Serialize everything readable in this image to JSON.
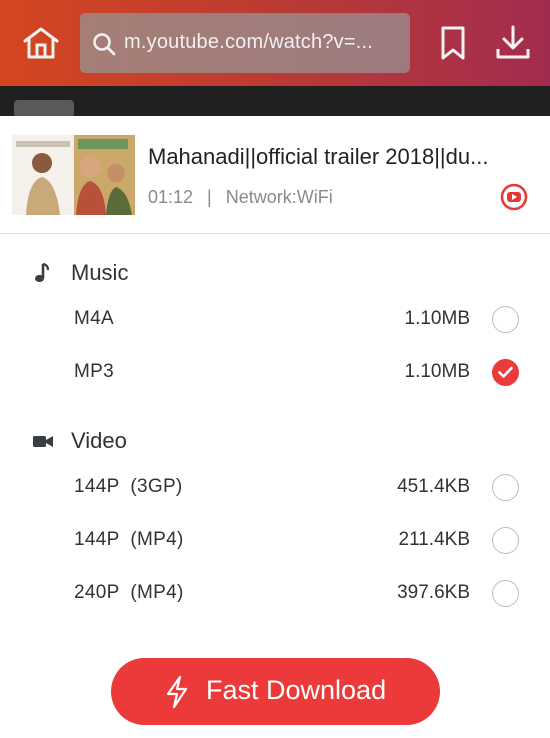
{
  "browser": {
    "url": "m.youtube.com/watch?v=...",
    "icons": [
      "home-icon",
      "search-icon",
      "bookmark-icon",
      "download-icon"
    ]
  },
  "background_page": {
    "site_label": "YouTube"
  },
  "video": {
    "title": "Mahanadi||official trailer 2018||du...",
    "duration": "01:12",
    "separator": "|",
    "network": "Network:WiFi",
    "source_icon": "youtube-icon"
  },
  "sections": {
    "music": {
      "label": "Music",
      "icon": "music-note-icon",
      "options": [
        {
          "label": "M4A",
          "size": "1.10MB",
          "selected": false
        },
        {
          "label": "MP3",
          "size": "1.10MB",
          "selected": true
        }
      ]
    },
    "video": {
      "label": "Video",
      "icon": "video-camera-icon",
      "options": [
        {
          "label": "144P  (3GP)",
          "size": "451.4KB",
          "selected": false
        },
        {
          "label": "144P  (MP4)",
          "size": "211.4KB",
          "selected": false
        },
        {
          "label": "240P  (MP4)",
          "size": "397.6KB",
          "selected": false
        }
      ]
    }
  },
  "action": {
    "label": "Fast Download",
    "icon": "lightning-icon"
  },
  "colors": {
    "accent": "#ec3a3a",
    "topbar_start": "#d4461f",
    "topbar_end": "#a22c4f"
  }
}
